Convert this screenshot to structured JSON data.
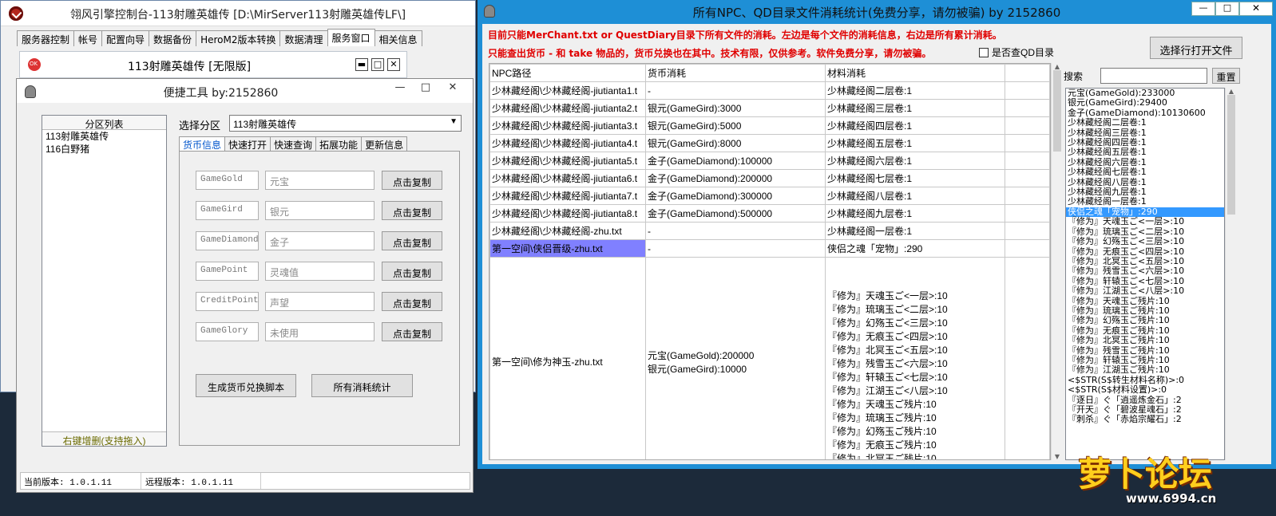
{
  "main_window": {
    "title": "翎风引擎控制台-113射雕英雄传 [D:\\MirServer113射雕英雄传LF\\]",
    "tabs": [
      "服务器控制",
      "帐号",
      "配置向导",
      "数据备份",
      "HeroM2版本转换",
      "数据清理",
      "服务窗口",
      "相关信息"
    ],
    "selected_tab": "服务窗口"
  },
  "server_window": {
    "title": "113射雕英雄传 [无限版]",
    "buttons": [
      "▬",
      "□",
      "✕"
    ]
  },
  "tool_window": {
    "title": "便捷工具 by:2152860",
    "caption_buttons": [
      "—",
      "□",
      "✕"
    ],
    "partition_list_header": "分区列表",
    "partitions": [
      "113射雕英雄传",
      "116白野猪"
    ],
    "partition_footer": "右键增删(支持拖入)",
    "select_partition_label": "选择分区",
    "select_partition_value": "113射雕英雄传",
    "tabs": [
      "货币信息",
      "快速打开",
      "快速查询",
      "拓展功能",
      "更新信息"
    ],
    "selected_tab": "货币信息",
    "currencies": [
      {
        "code": "GameGold",
        "name": "元宝",
        "button": "点击复制"
      },
      {
        "code": "GameGird",
        "name": "银元",
        "button": "点击复制"
      },
      {
        "code": "GameDiamond",
        "name": "金子",
        "button": "点击复制"
      },
      {
        "code": "GamePoint",
        "name": "灵魂值",
        "button": "点击复制"
      },
      {
        "code": "CreditPoint",
        "name": "声望",
        "button": "点击复制"
      },
      {
        "code": "GameGlory",
        "name": "未使用",
        "button": "点击复制"
      }
    ],
    "generate_button": "生成货币兑换脚本",
    "stats_button": "所有消耗统计",
    "current_version": "当前版本: 1.0.1.11",
    "remote_version": "远程版本: 1.0.1.11"
  },
  "stats_window": {
    "title": "所有NPC、QD目录文件消耗统计(免费分享，请勿被骗)    by 2152860",
    "notice1": "目前只能MerChant.txt or QuestDiary目录下所有文件的消耗。左边是每个文件的消耗信息，右边是所有累计消耗。",
    "notice2": "只能查出货币 - 和 take 物品的，货币兑换也在其中。技术有限，仅供参考。软件免费分享，请勿被骗。",
    "checkbox_label": "是否查QD目录",
    "open_file_button": "选择行打开文件",
    "search_label": "搜索",
    "reset_button": "重置",
    "columns": [
      "NPC路径",
      "货币消耗",
      "材料消耗"
    ],
    "rows": [
      {
        "path": "少林藏经阁\\少林藏经阁-jiutianta1.t",
        "currency": "-",
        "material": "少林藏经阁二层卷:1"
      },
      {
        "path": "少林藏经阁\\少林藏经阁-jiutianta2.t",
        "currency": "银元(GameGird):3000",
        "material": "少林藏经阁三层卷:1"
      },
      {
        "path": "少林藏经阁\\少林藏经阁-jiutianta3.t",
        "currency": "银元(GameGird):5000",
        "material": "少林藏经阁四层卷:1"
      },
      {
        "path": "少林藏经阁\\少林藏经阁-jiutianta4.t",
        "currency": "银元(GameGird):8000",
        "material": "少林藏经阁五层卷:1"
      },
      {
        "path": "少林藏经阁\\少林藏经阁-jiutianta5.t",
        "currency": "金子(GameDiamond):100000",
        "material": "少林藏经阁六层卷:1"
      },
      {
        "path": "少林藏经阁\\少林藏经阁-jiutianta6.t",
        "currency": "金子(GameDiamond):200000",
        "material": "少林藏经阁七层卷:1"
      },
      {
        "path": "少林藏经阁\\少林藏经阁-jiutianta7.t",
        "currency": "金子(GameDiamond):300000",
        "material": "少林藏经阁八层卷:1"
      },
      {
        "path": "少林藏经阁\\少林藏经阁-jiutianta8.t",
        "currency": "金子(GameDiamond):500000",
        "material": "少林藏经阁九层卷:1"
      },
      {
        "path": "少林藏经阁\\少林藏经阁-zhu.txt",
        "currency": "-",
        "material": "少林藏经阁一层卷:1"
      },
      {
        "path": "第一空间\\侠侣晋级-zhu.txt",
        "currency": "-",
        "material": "侠侣之魂「宠物」:290"
      }
    ],
    "big_row": {
      "path": "第一空间\\修为神玉-zhu.txt",
      "currency1": "元宝(GameGold):200000",
      "currency2": "银元(GameGird):10000",
      "materials": [
        "『修为』天魂玉ご<一层>:10",
        "『修为』琉璃玉ご<二层>:10",
        "『修为』幻殇玉ご<三层>:10",
        "『修为』无痕玉ご<四层>:10",
        "『修为』北冥玉ご<五层>:10",
        "『修为』残雪玉ご<六层>:10",
        "『修为』轩辕玉ご<七层>:10",
        "『修为』江湖玉ご<八层>:10",
        "『修为』天魂玉ご残片:10",
        "『修为』琉璃玉ご残片:10",
        "『修为』幻殇玉ご残片:10",
        "『修为』无痕玉ご残片:10",
        "『修为』北冥玉ご残片:10"
      ]
    },
    "totals": [
      "元宝(GameGold):233000",
      "银元(GameGird):29400",
      "金子(GameDiamond):10130600",
      "少林藏经阁二层卷:1",
      "少林藏经阁三层卷:1",
      "少林藏经阁四层卷:1",
      "少林藏经阁五层卷:1",
      "少林藏经阁六层卷:1",
      "少林藏经阁七层卷:1",
      "少林藏经阁八层卷:1",
      "少林藏经阁九层卷:1",
      "少林藏经阁一层卷:1",
      "侠侣之魂「宠物」:290",
      "『修为』天魂玉ご<一层>:10",
      "『修为』琉璃玉ご<二层>:10",
      "『修为』幻殇玉ご<三层>:10",
      "『修为』无痕玉ご<四层>:10",
      "『修为』北冥玉ご<五层>:10",
      "『修为』残雪玉ご<六层>:10",
      "『修为』轩辕玉ご<七层>:10",
      "『修为』江湖玉ご<八层>:10",
      "『修为』天魂玉ご残片:10",
      "『修为』琉璃玉ご残片:10",
      "『修为』幻殇玉ご残片:10",
      "『修为』无痕玉ご残片:10",
      "『修为』北冥玉ご残片:10",
      "『修为』残雪玉ご残片:10",
      "『修为』轩辕玉ご残片:10",
      "『修为』江湖玉ご残片:10",
      "<$STR(S$转生材料名称)>:0",
      "<$STR(S$材料设置)>:0",
      "『逐日』ぐ「逍遥炼金石」:2",
      "『开天』ぐ「碧波星魂石」:2",
      "『刺杀』ぐ「赤焰宗耀石」:2"
    ],
    "selected_total": "侠侣之魂「宠物」:290"
  },
  "watermark": {
    "brand": "萝卜论坛",
    "url": "www.6994.cn"
  },
  "colors": {
    "title_blue": "#1e8fd6",
    "selection": "#3399ff",
    "highlight_cell": "#8080ff",
    "notice_red": "#e00000"
  }
}
